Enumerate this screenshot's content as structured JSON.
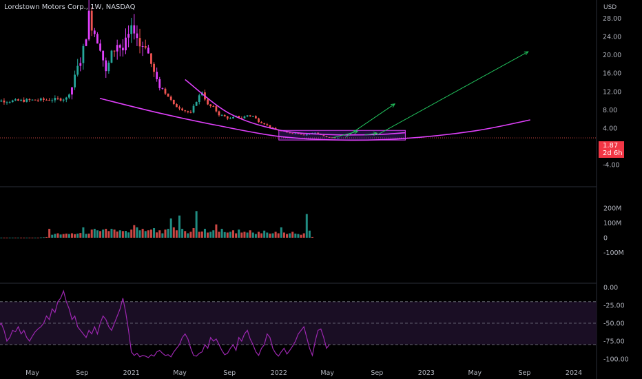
{
  "header": {
    "title": "Lordstown Motors Corp., 1W, NASDAQ"
  },
  "price_badge": {
    "price": "1.87",
    "countdown": "2d 6h"
  },
  "colors": {
    "background": "#000000",
    "up": "#26a69a",
    "down": "#ef5350",
    "candle_accent": "#e040fb",
    "trendline": "#e040fb",
    "projection_arrow": "#22c55e",
    "box_fill": "#7c3aed",
    "rsi_line": "#9c27b0",
    "rsi_band": "#1a0e24",
    "axis_text": "#b2b5be",
    "pane_divider": "#2a2e39",
    "badge": "#f23645"
  },
  "chart_data": [
    {
      "type": "line",
      "name_panel": "price",
      "title": "Lordstown Motors Corp., 1W, NASDAQ",
      "ylabel": "USD",
      "yscale": "linear",
      "ylim": [
        -6,
        30
      ],
      "yticks": [
        "28.00",
        "24.00",
        "20.00",
        "16.00",
        "12.00",
        "8.00",
        "4.00",
        "0.00",
        "-4.00"
      ],
      "ytick_values": [
        28,
        24,
        20,
        16,
        12,
        8,
        4,
        0,
        -4
      ],
      "last_price": 1.87,
      "x_ticks": [
        "May",
        "Sep",
        "2021",
        "May",
        "Sep",
        "2022",
        "May",
        "Sep",
        "2023",
        "May",
        "Sep",
        "2024"
      ],
      "x_tick_dates": [
        "2020-05-01",
        "2020-09-01",
        "2021-01-01",
        "2021-05-01",
        "2021-09-01",
        "2022-01-01",
        "2022-05-01",
        "2022-09-01",
        "2023-01-01",
        "2023-05-01",
        "2023-09-01",
        "2024-01-01"
      ],
      "xlim": [
        "2020-01-01",
        "2024-04-15"
      ],
      "weekly_close": [
        [
          "2020-01-03",
          10.0
        ],
        [
          "2020-02-07",
          10.0
        ],
        [
          "2020-03-06",
          9.9
        ],
        [
          "2020-04-03",
          10.0
        ],
        [
          "2020-05-01",
          10.1
        ],
        [
          "2020-06-05",
          10.2
        ],
        [
          "2020-07-03",
          10.3
        ],
        [
          "2020-07-24",
          10.5
        ],
        [
          "2020-08-07",
          13.0
        ],
        [
          "2020-08-21",
          17.0
        ],
        [
          "2020-09-04",
          21.0
        ],
        [
          "2020-09-18",
          28.5
        ],
        [
          "2020-10-02",
          25.0
        ],
        [
          "2020-10-16",
          22.0
        ],
        [
          "2020-10-30",
          16.0
        ],
        [
          "2020-11-13",
          20.0
        ],
        [
          "2020-11-27",
          22.5
        ],
        [
          "2020-12-11",
          21.0
        ],
        [
          "2020-12-25",
          24.0
        ],
        [
          "2021-01-08",
          26.0
        ],
        [
          "2021-01-22",
          22.0
        ],
        [
          "2021-02-05",
          22.5
        ],
        [
          "2021-02-19",
          18.0
        ],
        [
          "2021-03-05",
          14.0
        ],
        [
          "2021-03-19",
          12.5
        ],
        [
          "2021-04-02",
          11.0
        ],
        [
          "2021-04-16",
          9.0
        ],
        [
          "2021-04-30",
          8.5
        ],
        [
          "2021-05-14",
          7.8
        ],
        [
          "2021-05-28",
          7.2
        ],
        [
          "2021-06-11",
          10.0
        ],
        [
          "2021-06-25",
          12.0
        ],
        [
          "2021-07-09",
          9.0
        ],
        [
          "2021-07-23",
          8.5
        ],
        [
          "2021-08-06",
          7.0
        ],
        [
          "2021-08-20",
          6.5
        ],
        [
          "2021-09-03",
          6.0
        ],
        [
          "2021-09-17",
          6.5
        ],
        [
          "2021-10-01",
          6.2
        ],
        [
          "2021-10-15",
          6.8
        ],
        [
          "2021-10-29",
          6.6
        ],
        [
          "2021-11-12",
          5.5
        ],
        [
          "2021-11-26",
          5.0
        ],
        [
          "2021-12-10",
          4.2
        ],
        [
          "2021-12-24",
          3.6
        ],
        [
          "2022-01-07",
          3.4
        ],
        [
          "2022-01-21",
          3.0
        ],
        [
          "2022-02-04",
          2.9
        ],
        [
          "2022-02-18",
          2.8
        ],
        [
          "2022-03-04",
          2.5
        ],
        [
          "2022-03-18",
          2.8
        ],
        [
          "2022-04-01",
          3.0
        ],
        [
          "2022-04-15",
          2.5
        ],
        [
          "2022-04-29",
          2.0
        ],
        [
          "2022-05-13",
          1.9
        ],
        [
          "2022-05-27",
          1.87
        ]
      ],
      "annotations": {
        "upper_arc": [
          [
            "2021-05-14",
            14.6
          ],
          [
            "2021-09-01",
            7.2
          ],
          [
            "2022-01-01",
            3.6
          ],
          [
            "2022-05-01",
            2.6
          ],
          [
            "2022-09-01",
            2.6
          ],
          [
            "2022-11-10",
            3.0
          ]
        ],
        "lower_arc": [
          [
            "2020-10-15",
            10.5
          ],
          [
            "2021-03-01",
            7.5
          ],
          [
            "2021-08-01",
            4.6
          ],
          [
            "2022-01-01",
            2.2
          ],
          [
            "2022-06-01",
            1.4
          ],
          [
            "2022-11-01",
            1.7
          ],
          [
            "2023-05-01",
            3.4
          ],
          [
            "2023-09-15",
            5.8
          ]
        ],
        "box": {
          "x0": "2022-01-01",
          "x1": "2022-11-10",
          "y0": 1.4,
          "y1": 3.5
        },
        "arrows": [
          {
            "from": [
              "2022-05-15",
              1.9
            ],
            "to": [
              "2022-07-15",
              3.3
            ]
          },
          {
            "from": [
              "2022-06-15",
              2.0
            ],
            "to": [
              "2022-10-15",
              9.3
            ]
          },
          {
            "from": [
              "2022-08-01",
              2.5
            ],
            "to": [
              "2022-09-01",
              2.9
            ]
          },
          {
            "from": [
              "2022-09-01",
              2.5
            ],
            "to": [
              "2023-09-10",
              20.7
            ]
          }
        ]
      }
    },
    {
      "type": "bar",
      "name_panel": "volume",
      "ylim": [
        -115,
        200
      ],
      "yticks": [
        "200M",
        "100M",
        "0",
        "-100M"
      ],
      "ytick_values": [
        200,
        100,
        0,
        -100
      ],
      "unit": "M",
      "values": [
        1,
        1,
        1,
        1,
        1,
        1,
        1,
        1,
        1,
        1,
        1,
        1,
        1,
        1,
        1,
        1,
        1,
        1,
        1,
        1,
        2,
        3,
        5,
        60,
        20,
        26,
        30,
        22,
        25,
        28,
        25,
        30,
        24,
        28,
        32,
        70,
        26,
        28,
        55,
        60,
        50,
        45,
        55,
        60,
        45,
        60,
        55,
        42,
        50,
        45,
        46,
        36,
        55,
        85,
        70,
        50,
        60,
        45,
        50,
        55,
        65,
        36,
        50,
        30,
        55,
        60,
        130,
        70,
        50,
        150,
        60,
        45,
        30,
        40,
        65,
        180,
        40,
        42,
        60,
        35,
        40,
        50,
        90,
        40,
        60,
        38,
        35,
        40,
        50,
        30,
        55,
        35,
        40,
        35,
        50,
        35,
        25,
        40,
        30,
        48,
        35,
        28,
        30,
        40,
        30,
        70,
        35,
        25,
        30,
        40,
        28,
        25,
        20,
        30,
        160,
        48,
        5
      ]
    },
    {
      "type": "line",
      "name_panel": "oscillator",
      "ylim": [
        -104,
        0
      ],
      "yticks": [
        "0.00",
        "-25.00",
        "-50.00",
        "-75.00",
        "-100.00"
      ],
      "ytick_values": [
        0,
        -25,
        -50,
        -75,
        -100
      ],
      "band": [
        -80,
        -20
      ],
      "midline": -50,
      "values": [
        -45,
        -55,
        -50,
        -60,
        -65,
        -55,
        -50,
        -60,
        -75,
        -70,
        -60,
        -62,
        -55,
        -65,
        -60,
        -70,
        -75,
        -68,
        -62,
        -58,
        -55,
        -50,
        -40,
        -45,
        -30,
        -35,
        -20,
        -15,
        -5,
        -20,
        -30,
        -45,
        -40,
        -55,
        -60,
        -65,
        -70,
        -60,
        -65,
        -55,
        -65,
        -50,
        -40,
        -45,
        -55,
        -60,
        -50,
        -40,
        -30,
        -15,
        -35,
        -60,
        -90,
        -95,
        -92,
        -97,
        -95,
        -96,
        -98,
        -94,
        -96,
        -90,
        -88,
        -92,
        -95,
        -94,
        -97,
        -90,
        -85,
        -80,
        -70,
        -65,
        -72,
        -85,
        -95,
        -96,
        -92,
        -90,
        -80,
        -85,
        -70,
        -75,
        -72,
        -80,
        -88,
        -94,
        -92,
        -85,
        -80,
        -88,
        -70,
        -75,
        -65,
        -60,
        -72,
        -80,
        -90,
        -95,
        -85,
        -80,
        -65,
        -70,
        -85,
        -92,
        -96,
        -90,
        -85,
        -93,
        -88,
        -82,
        -75,
        -65,
        -60,
        -55,
        -70,
        -85,
        -95,
        -75,
        -60,
        -58,
        -70,
        -85,
        -80
      ]
    }
  ]
}
